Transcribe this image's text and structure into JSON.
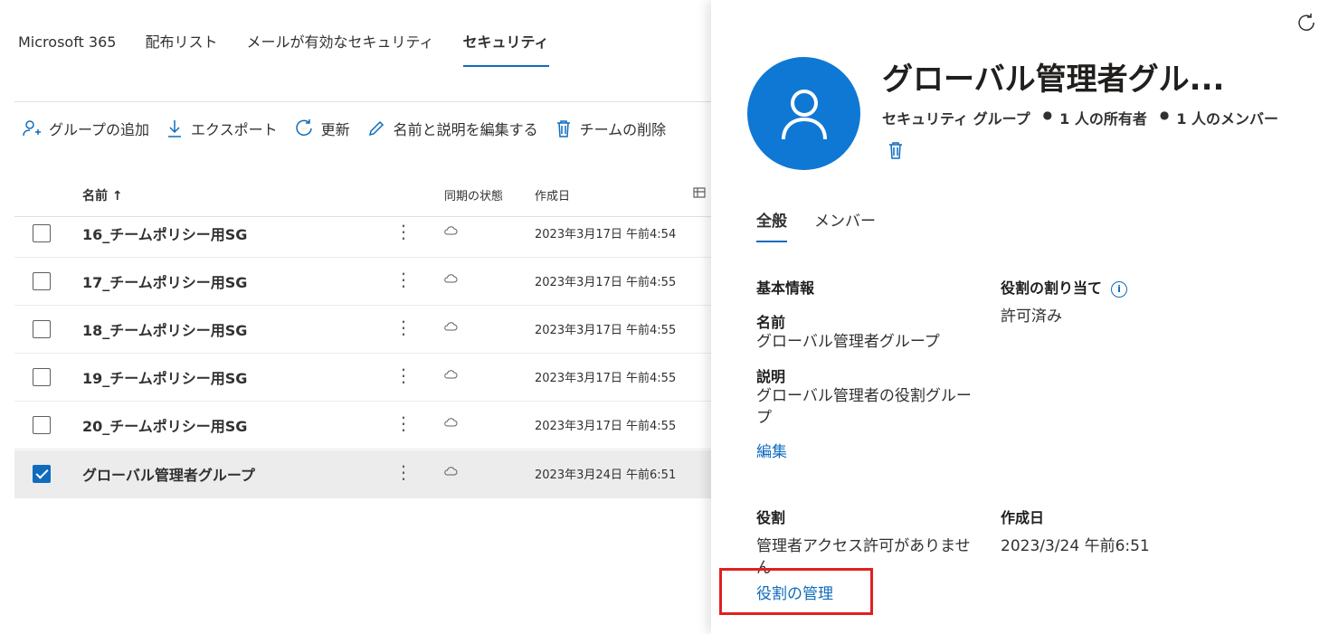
{
  "tabs": [
    {
      "label": "Microsoft 365",
      "active": false
    },
    {
      "label": "配布リスト",
      "active": false
    },
    {
      "label": "メールが有効なセキュリティ",
      "active": false
    },
    {
      "label": "セキュリティ",
      "active": true
    }
  ],
  "toolbar": {
    "add_group": "グループの追加",
    "export": "エクスポート",
    "refresh": "更新",
    "edit_name_desc": "名前と説明を編集する",
    "delete_team": "チームの削除"
  },
  "table": {
    "columns": {
      "name": "名前 ↑",
      "sync": "同期の状態",
      "created": "作成日"
    },
    "rows": [
      {
        "name": "16_チームポリシー用SG",
        "created": "2023年3月17日 午前4:54",
        "checked": false
      },
      {
        "name": "17_チームポリシー用SG",
        "created": "2023年3月17日 午前4:55",
        "checked": false
      },
      {
        "name": "18_チームポリシー用SG",
        "created": "2023年3月17日 午前4:55",
        "checked": false
      },
      {
        "name": "19_チームポリシー用SG",
        "created": "2023年3月17日 午前4:55",
        "checked": false
      },
      {
        "name": "20_チームポリシー用SG",
        "created": "2023年3月17日 午前4:55",
        "checked": false
      },
      {
        "name": "グローバル管理者グループ",
        "created": "2023年3月24日 午前6:51",
        "checked": true
      }
    ]
  },
  "panel": {
    "title": "グローバル管理者グル...",
    "type": "セキュリティ グループ",
    "owners": "1 人の所有者",
    "members": "1 人のメンバー",
    "tabs": {
      "general": "全般",
      "members": "メンバー"
    },
    "basic_info": "基本情報",
    "name_label": "名前",
    "name_value": "グローバル管理者グループ",
    "desc_label": "説明",
    "desc_value": "グローバル管理者の役割グループ",
    "edit_link": "編集",
    "role_assign_label": "役割の割り当て",
    "role_assign_value": "許可済み",
    "role_label": "役割",
    "role_value": "管理者アクセス許可がありません",
    "manage_roles_link": "役割の管理",
    "created_label": "作成日",
    "created_value": "2023/3/24 午前6:51"
  },
  "colors": {
    "accent": "#0f6cbd",
    "avatar": "#0f78d4",
    "highlight": "#e02020"
  }
}
